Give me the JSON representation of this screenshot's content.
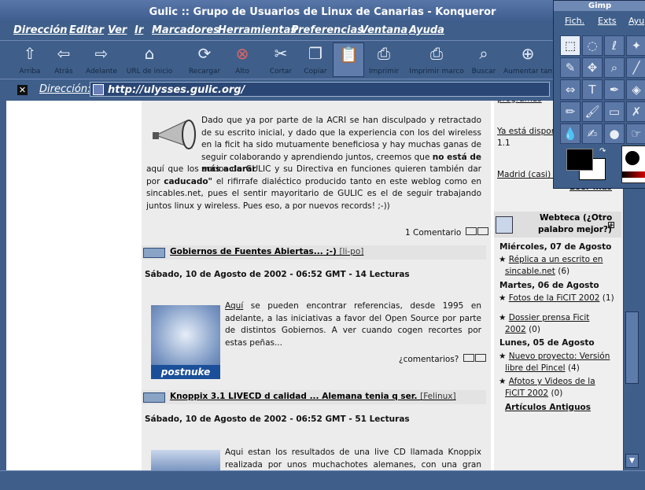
{
  "window": {
    "title": "Gulic :: Grupo de Usuarios de Linux de Canarias - Konqueror"
  },
  "menu": [
    "Dirección",
    "Editar",
    "Ver",
    "Ir",
    "Marcadores",
    "Herramientas",
    "Preferencias",
    "Ventana",
    "Ayuda"
  ],
  "toolbar": {
    "back": "Atrás",
    "up": "Arriba",
    "forward": "Adelante",
    "home": "URL de inicio",
    "reload": "Recargar",
    "stop": "Alto",
    "cut": "Cortar",
    "copy": "Copiar",
    "print": "Imprimir",
    "print_frame": "Imprimir marco",
    "find": "Buscar",
    "zoom": "Aumentar tam"
  },
  "address": {
    "label": "Dirección:",
    "url": "http://ulysses.gulic.org/"
  },
  "article1": {
    "p1": "Dado que ya por parte de la ACRI se han disculpado y retractado de su escrito inicial, y dado que la experiencia con los del wireless en la ficit ha sido mutuamente beneficiosa y hay muchas ganas de seguir colaborando y aprendiendo juntos, creemos que",
    "p1_bold": "no está de más aclarar",
    "p2": "aquí que los socios de GULIC y su Directiva en funciones quieren también dar por",
    "p2_bold": "caducado\"",
    "p3": "el rifirrafe dialéctico producido tanto en este weblog como en sincables.net, pues el sentir mayoritario de GULIC es el de seguir trabajando juntos linux y wireless. Pues eso, a por nuevos records! ;-))",
    "comments": "1 Comentario"
  },
  "article2": {
    "title": "Gobiernos de Fuentes Abiertas... ;-)",
    "cat": "[li-po]",
    "date": "Sábado, 10 de Agosto de 2002 - 06:52 GMT - 14 Lecturas",
    "link": "Aquí",
    "body": "se pueden encontrar referencias, desde 1995 en adelante, a las iniciativas a favor del Open Source por parte de distintos Gobiernos. A ver cuando cogen recortes por estas peñas...",
    "comments": "¿comentarios?",
    "logo": "postnuke"
  },
  "article3": {
    "title": "Knoppix 3.1 LIVECD d calidad ... Alemana tenia q ser.",
    "cat": "[Felinux]",
    "date": "Sábado, 10 de Agosto de 2002 - 06:52 GMT - 51 Lecturas",
    "body": "Aqui estan los resultados de una live CD llamada Knoppix realizada por unos muchachotes alemanes, con una gran calidad, me ha"
  },
  "sidebar": {
    "top1": "programas",
    "top2": "Ya está dispon",
    "top3": "1.1",
    "top4": "Madrid (casi) s",
    "top5": "Leer más",
    "box_title1": "Webteca (¿Otro",
    "box_title2": "palabro mejor?)",
    "d1": "Miércoles, 07 de Agosto",
    "l1a": "Réplica a un escrito en",
    "l1b": "sincable.net",
    "l1c": "(6)",
    "d2": "Martes, 06 de Agosto",
    "l2": "Fotos de la FiCIT 2002",
    "l2c": "(1)",
    "l3a": "Dossier prensa Ficit",
    "l3b": "2002",
    "l3c": "(0)",
    "d3": "Lunes, 05 de Agosto",
    "l4a": "Nuevo proyecto: Versión",
    "l4b": "libre del Pincel",
    "l4c": "(4)",
    "l5a": "Afotos y Videos de la",
    "l5b": "FiCIT 2002",
    "l5c": "(0)",
    "more": "Artículos Antiguos"
  },
  "gimp": {
    "title": "Gimp",
    "m1": "Fich.",
    "m2": "Exts",
    "m3": "Ayu"
  }
}
